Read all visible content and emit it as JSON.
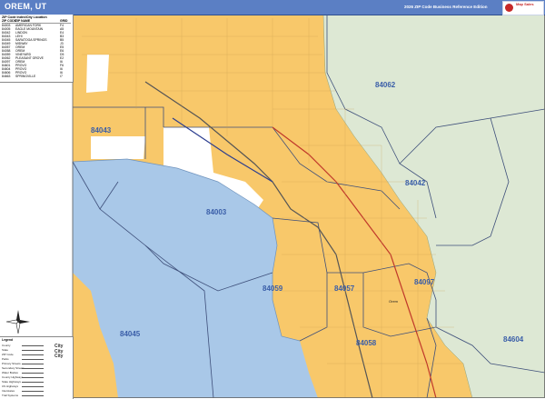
{
  "header": {
    "title": "OREM, UT",
    "edition": "2026 ZIP Code Business Reference Edition",
    "logo": "Map Sales",
    "colors": {
      "bar": "#5b7fc4",
      "urban": "#f8c86a",
      "water": "#a9c8e8",
      "forest": "#dde8d4",
      "zip_line": "#3e4f7a"
    }
  },
  "zip_index": {
    "title": "ZIP Code Index/City Location",
    "columns": [
      "ZIP CODE",
      "ZIP NAME",
      "GRID"
    ],
    "rows": [
      [
        "84003",
        "AMERICAN FORK",
        "F4"
      ],
      [
        "84005",
        "EAGLE MOUNTAIN",
        "A5"
      ],
      [
        "84042",
        "LINDON",
        "E4"
      ],
      [
        "84043",
        "LEHI",
        "B3"
      ],
      [
        "84045",
        "SARATOGA SPRINGS",
        "B5"
      ],
      [
        "84049",
        "MIDWAY",
        "J3"
      ],
      [
        "84057",
        "OREM",
        "E5"
      ],
      [
        "84058",
        "OREM",
        "E6"
      ],
      [
        "84059",
        "VINEYARD",
        "D5"
      ],
      [
        "84062",
        "PLEASANT GROVE",
        "E2"
      ],
      [
        "84097",
        "OREM",
        "I6"
      ],
      [
        "84601",
        "PROVO",
        "F6"
      ],
      [
        "84604",
        "PROVO",
        "I6"
      ],
      [
        "84606",
        "PROVO",
        "I6"
      ],
      [
        "84663",
        "SPRINGVILLE",
        "I7"
      ]
    ]
  },
  "map": {
    "zip_labels": {
      "z84062": "84062",
      "z84043": "84043",
      "z84042": "84042",
      "z84003": "84003",
      "z84059": "84059",
      "z84057": "84057",
      "z84097": "84097",
      "z84045": "84045",
      "z84058": "84058",
      "z84604": "84604"
    },
    "city": "Orem"
  },
  "legend": {
    "title": "Legend",
    "items": [
      "County",
      "State",
      "ZIP Code",
      "Parks",
      "Primary Streets",
      "Secondary Streets",
      "Water Bodies",
      "County Highways",
      "State Highways",
      "US Highways",
      "Interstates",
      "Trail Systems"
    ],
    "city_sample": [
      "City",
      "City",
      "City"
    ]
  },
  "compass": {
    "north": "N"
  }
}
